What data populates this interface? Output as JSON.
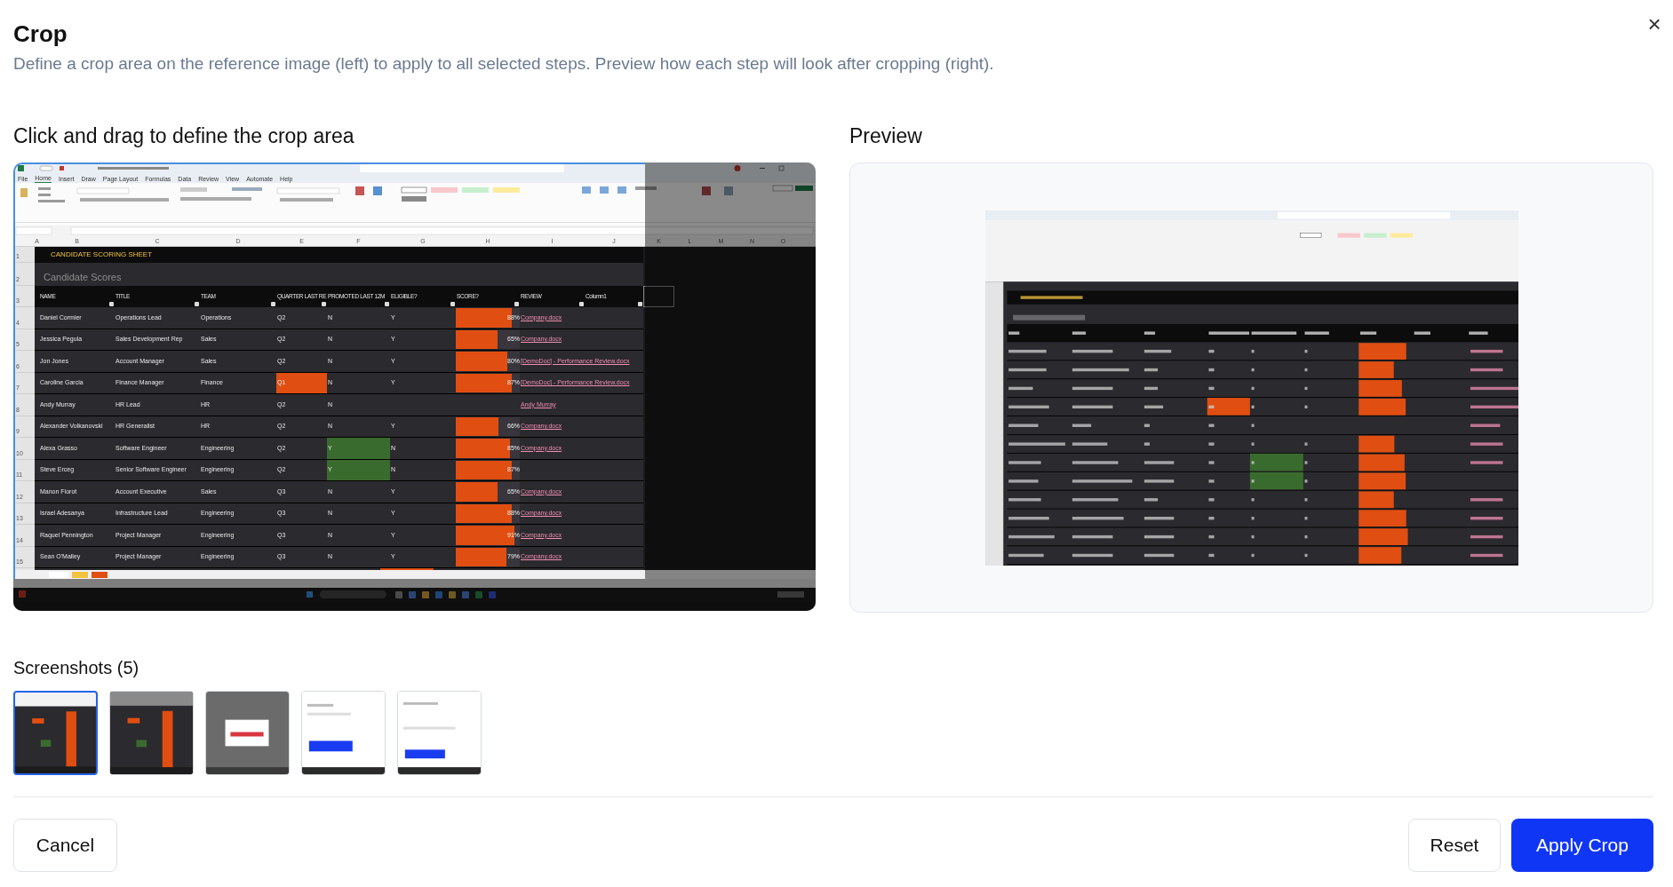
{
  "dialog": {
    "title": "Crop",
    "description": "Define a crop area on the reference image (left) to apply to all selected steps. Preview how each step will look after cropping (right).",
    "close": "×"
  },
  "reference": {
    "heading": "Click and drag to define the crop area",
    "menu_tabs": [
      {
        "label": "File",
        "selected": false
      },
      {
        "label": "Home",
        "selected": true
      },
      {
        "label": "Insert",
        "selected": false
      },
      {
        "label": "Draw",
        "selected": false
      },
      {
        "label": "Page Layout",
        "selected": false
      },
      {
        "label": "Formulas",
        "selected": false
      },
      {
        "label": "Data",
        "selected": false
      },
      {
        "label": "Review",
        "selected": false
      },
      {
        "label": "View",
        "selected": false
      },
      {
        "label": "Automate",
        "selected": false
      },
      {
        "label": "Help",
        "selected": false
      }
    ],
    "column_letters": [
      "A",
      "B",
      "C",
      "D",
      "E",
      "F",
      "G",
      "H",
      "I",
      "J",
      "K",
      "L",
      "M",
      "N",
      "O"
    ],
    "sheet_title": {
      "row_number": "1",
      "text": "CANDIDATE SCORING SHEET"
    },
    "sheet_subtitle": {
      "row_number": "2",
      "text": "Candidate Scores"
    },
    "header": {
      "row_number": "3",
      "columns": [
        "NAME",
        "TITLE",
        "TEAM",
        "QUARTER LAST RE",
        "PROMOTED LAST 12M",
        "ELIGIBLE?",
        "SCORE?",
        "REVIEW",
        "Column1"
      ]
    },
    "rows": [
      {
        "row_number": "4",
        "name": "Daniel Cormier",
        "title": "Operations Lead",
        "team": "Operations",
        "quarter": "Q2",
        "quarter_highlighted": false,
        "promoted": "N",
        "promoted_highlighted": false,
        "eligible": "Y",
        "score": "88%",
        "level": 0.88,
        "review": "Company.docx"
      },
      {
        "row_number": "5",
        "name": "Jessica Pegula",
        "title": "Sales Development Rep",
        "team": "Sales",
        "quarter": "Q2",
        "quarter_highlighted": false,
        "promoted": "N",
        "promoted_highlighted": false,
        "eligible": "Y",
        "score": "65%",
        "level": 0.65,
        "review": "Company.docx"
      },
      {
        "row_number": "6",
        "name": "Jon Jones",
        "title": "Account Manager",
        "team": "Sales",
        "quarter": "Q2",
        "quarter_highlighted": false,
        "promoted": "N",
        "promoted_highlighted": false,
        "eligible": "Y",
        "score": "80%",
        "level": 0.8,
        "review": "[DemoDoc] - Performance Review.docx"
      },
      {
        "row_number": "7",
        "name": "Caroline Garcia",
        "title": "Finance Manager",
        "team": "Finance",
        "quarter": "Q1",
        "quarter_highlighted": true,
        "promoted": "N",
        "promoted_highlighted": false,
        "eligible": "Y",
        "score": "87%",
        "level": 0.87,
        "review": "[DemoDoc] - Performance Review.docx"
      },
      {
        "row_number": "8",
        "name": "Andy Murray",
        "title": "HR Lead",
        "team": "HR",
        "quarter": "Q2",
        "quarter_highlighted": false,
        "promoted": "N",
        "promoted_highlighted": false,
        "review": "Andy Murray"
      },
      {
        "row_number": "9",
        "name": "Alexander Volkanovski",
        "title": "HR Generalist",
        "team": "HR",
        "quarter": "Q2",
        "quarter_highlighted": false,
        "promoted": "N",
        "promoted_highlighted": false,
        "eligible": "Y",
        "score": "66%",
        "level": 0.66,
        "review": "Company.docx"
      },
      {
        "row_number": "10",
        "name": "Alexa Grasso",
        "title": "Software Engineer",
        "team": "Engineering",
        "quarter": "Q2",
        "quarter_highlighted": false,
        "promoted": "Y",
        "promoted_highlighted": true,
        "eligible": "N",
        "score": "85%",
        "level": 0.85,
        "review": "Company.docx"
      },
      {
        "row_number": "11",
        "name": "Steve Erceg",
        "title": "Senior Software Engineer",
        "team": "Engineering",
        "quarter": "Q2",
        "quarter_highlighted": false,
        "promoted": "Y",
        "promoted_highlighted": true,
        "eligible": "N",
        "score": "87%",
        "level": 0.87
      },
      {
        "row_number": "12",
        "name": "Manon Fiorot",
        "title": "Account Executive",
        "team": "Sales",
        "quarter": "Q3",
        "quarter_highlighted": false,
        "promoted": "N",
        "promoted_highlighted": false,
        "eligible": "Y",
        "score": "65%",
        "level": 0.65,
        "review": "Company.docx"
      },
      {
        "row_number": "13",
        "name": "Israel Adesanya",
        "title": "Infrastructure Lead",
        "team": "Engineering",
        "quarter": "Q3",
        "quarter_highlighted": false,
        "promoted": "N",
        "promoted_highlighted": false,
        "eligible": "Y",
        "score": "88%",
        "level": 0.88,
        "review": "Company.docx"
      },
      {
        "row_number": "14",
        "name": "Raquel Pennington",
        "title": "Project Manager",
        "team": "Engineering",
        "quarter": "Q3",
        "quarter_highlighted": false,
        "promoted": "N",
        "promoted_highlighted": false,
        "eligible": "Y",
        "score": "91%",
        "level": 0.91,
        "review": "Company.docx"
      },
      {
        "row_number": "15",
        "name": "Sean O'Malley",
        "title": "Project Manager",
        "team": "Engineering",
        "quarter": "Q3",
        "quarter_highlighted": false,
        "promoted": "N",
        "promoted_highlighted": false,
        "eligible": "Y",
        "score": "79%",
        "level": 0.79,
        "review": "Company.docx"
      }
    ]
  },
  "preview": {
    "heading": "Preview"
  },
  "screenshots": {
    "heading": "Screenshots (5)",
    "items": [
      {
        "kind": "spreadsheet",
        "selected": true
      },
      {
        "kind": "spreadsheet_dark",
        "selected": false
      },
      {
        "kind": "dialog",
        "selected": false
      },
      {
        "kind": "form",
        "selected": false
      },
      {
        "kind": "form_low",
        "selected": false
      }
    ]
  },
  "buttons": {
    "cancel": "Cancel",
    "reset": "Reset",
    "apply": "Apply Crop"
  }
}
